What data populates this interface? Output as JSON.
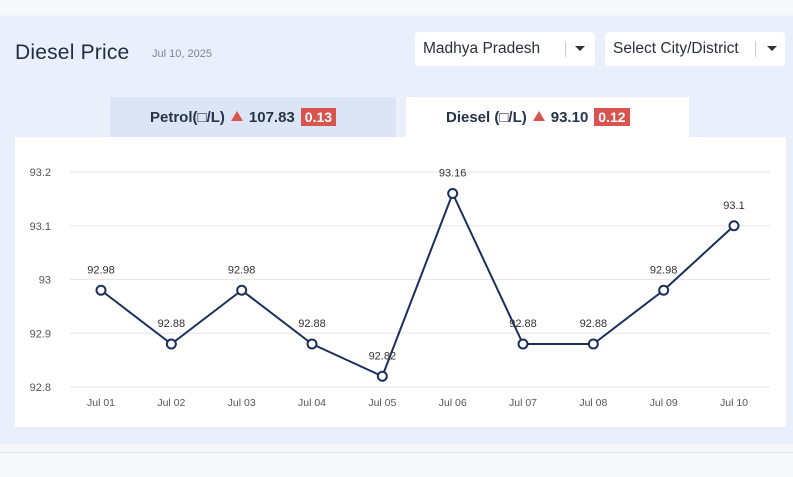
{
  "header": {
    "title": "Diesel Price",
    "date": "Jul 10, 2025"
  },
  "filters": {
    "state": "Madhya Pradesh",
    "city": "Select City/District"
  },
  "tabs": {
    "petrol": {
      "label": "Petrol(□/L)",
      "price": "107.83",
      "change": "0.13"
    },
    "diesel": {
      "label": "Diesel (□/L)",
      "price": "93.10",
      "change": "0.12"
    }
  },
  "colors": {
    "line": "#1b2f5c",
    "increase": "#d9534f",
    "active_tab": "#ffffff",
    "inactive_tab": "#dbe5f6"
  },
  "icons": {
    "tab_change": "triangle-up-icon",
    "select": "chevron-down-icon"
  },
  "chart_data": {
    "type": "line",
    "categories": [
      "Jul 01",
      "Jul 02",
      "Jul 03",
      "Jul 04",
      "Jul 05",
      "Jul 06",
      "Jul 07",
      "Jul 08",
      "Jul 09",
      "Jul 10"
    ],
    "series": [
      {
        "values": [
          92.98,
          92.88,
          92.98,
          92.88,
          92.82,
          93.16,
          92.88,
          92.88,
          92.98,
          93.1
        ],
        "labels": [
          "92.98",
          "92.88",
          "92.98",
          "92.88",
          "92.82",
          "93.16",
          "92.88",
          "92.88",
          "92.98",
          "93.1"
        ]
      }
    ],
    "ylim": [
      92.8,
      93.2
    ],
    "yticks": [
      92.8,
      92.9,
      93,
      93.1,
      93.2
    ],
    "ytick_labels": [
      "92.8",
      "92.9",
      "93",
      "93.1",
      "93.2"
    ],
    "grid": true,
    "markers": "hollow circles"
  }
}
